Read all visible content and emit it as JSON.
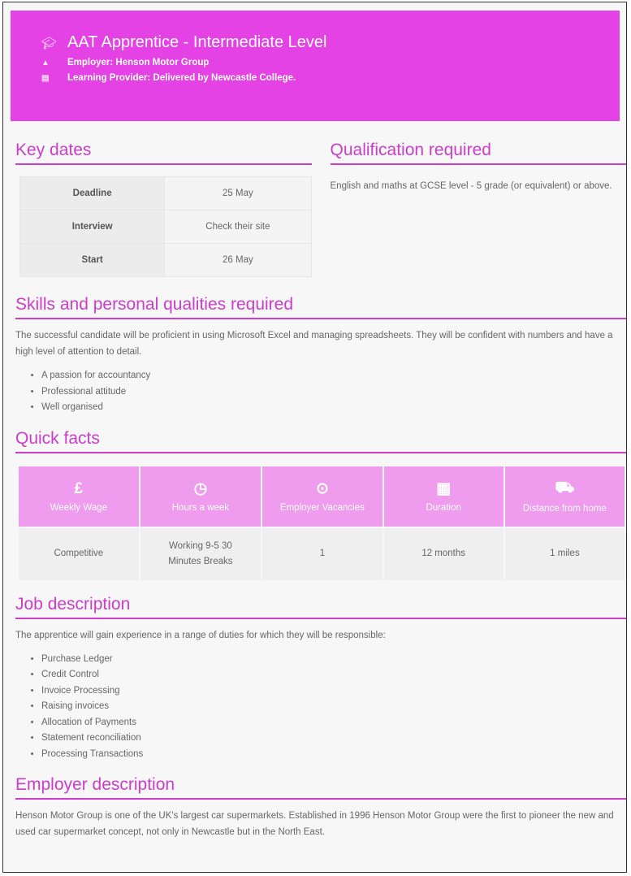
{
  "header": {
    "title": "AAT Apprentice - Intermediate Level",
    "employer": "Employer: Henson Motor Group",
    "provider": "Learning Provider: Delivered by Newcastle College.",
    "title_icon": "graduation-cap-icon",
    "employer_icon": "person-icon",
    "provider_icon": "building-icon"
  },
  "key_dates": {
    "heading": "Key dates",
    "rows": [
      {
        "label": "Deadline",
        "value": "25 May"
      },
      {
        "label": "Interview",
        "value": "Check their site"
      },
      {
        "label": "Start",
        "value": "26 May"
      }
    ]
  },
  "qualification": {
    "heading": "Qualification required",
    "text": "English and maths at GCSE level - 5 grade (or equivalent) or above."
  },
  "skills": {
    "heading": "Skills and personal qualities required",
    "text": "The successful candidate will be proficient in using Microsoft Excel and managing spreadsheets. They will be confident with numbers and have a high level of attention to detail.",
    "items": [
      "A passion for accountancy",
      "Professional attitude",
      "Well organised"
    ]
  },
  "quick_facts": {
    "heading": "Quick facts",
    "items": [
      {
        "icon": "pound-icon",
        "glyph": "£",
        "label": "Weekly Wage",
        "value": "Competitive"
      },
      {
        "icon": "clock-icon",
        "glyph": "◷",
        "label": "Hours a week",
        "value": "Working 9-5 30 Minutes Breaks"
      },
      {
        "icon": "target-icon",
        "glyph": "⊙",
        "label": "Employer Vacancies",
        "value": "1"
      },
      {
        "icon": "calendar-icon",
        "glyph": "▦",
        "label": "Duration",
        "value": "12 months"
      },
      {
        "icon": "car-icon",
        "glyph": "⛟",
        "label": "Distance from home",
        "value": "1 miles"
      }
    ]
  },
  "job": {
    "heading": "Job description",
    "text": "The apprentice will gain experience in a range of duties for which they will be responsible:",
    "items": [
      "Purchase Ledger",
      "Credit Control",
      "Invoice Processing",
      "Raising invoices",
      "Allocation of Payments",
      "Statement reconciliation",
      "Processing Transactions"
    ]
  },
  "employer_desc": {
    "heading": "Employer description",
    "text": "Henson Motor Group is one of the UK's largest car supermarkets. Established in 1996 Henson Motor Group were the first to pioneer the new and used car supermarket concept, not only in Newcastle but in the North East."
  },
  "colors": {
    "accent": "#cc3dcc",
    "banner": "#e442e4",
    "facts_header": "#ef9cef"
  }
}
